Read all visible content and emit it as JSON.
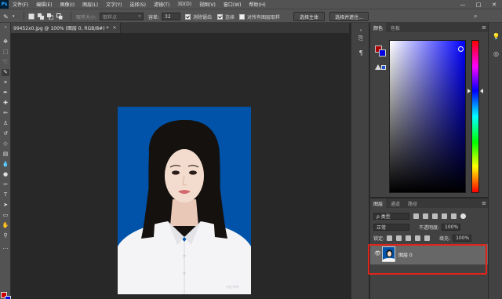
{
  "menubar": {
    "logo": "Ps",
    "items": [
      "文件(F)",
      "编辑(E)",
      "图像(I)",
      "图层(L)",
      "文字(Y)",
      "选择(S)",
      "滤镜(T)",
      "3D(D)",
      "视图(V)",
      "窗口(W)",
      "帮助(H)"
    ],
    "window_controls": [
      "—",
      "□",
      "✕"
    ]
  },
  "options": {
    "sample_size_label": "取样大小:",
    "sample_size_value": "取样点",
    "tolerance_label": "容差:",
    "tolerance_value": "32",
    "anti_alias": "消除锯齿",
    "contiguous": "连续",
    "sample_all_layers": "对所有图层取样",
    "select_subject": "选择主体",
    "select_and_mask": "选择并遮住..."
  },
  "document": {
    "tab_title": "99452x0.jpg @ 100% (图层 0, RGB/8#) *",
    "close": "×"
  },
  "color_panel": {
    "tabs": [
      "颜色",
      "色板"
    ],
    "fg_color": "#b00000",
    "bg_color": "#0000e0"
  },
  "layers_panel": {
    "tabs": [
      "图层",
      "通道",
      "路径"
    ],
    "filter_kind": "ρ 类型",
    "blend_mode": "正常",
    "opacity_label": "不透明度:",
    "opacity_value": "100%",
    "lock_label": "锁定:",
    "fill_label": "填充:",
    "fill_value": "100%",
    "layers": [
      {
        "name": "图层 0",
        "visible": true
      }
    ]
  },
  "photo": {
    "watermark": "小红书号:",
    "background_color": "#0053a8"
  },
  "colors": {
    "ui_dark": "#282828",
    "ui_mid": "#535353",
    "panel": "#424242",
    "highlight": "#e0241b"
  }
}
